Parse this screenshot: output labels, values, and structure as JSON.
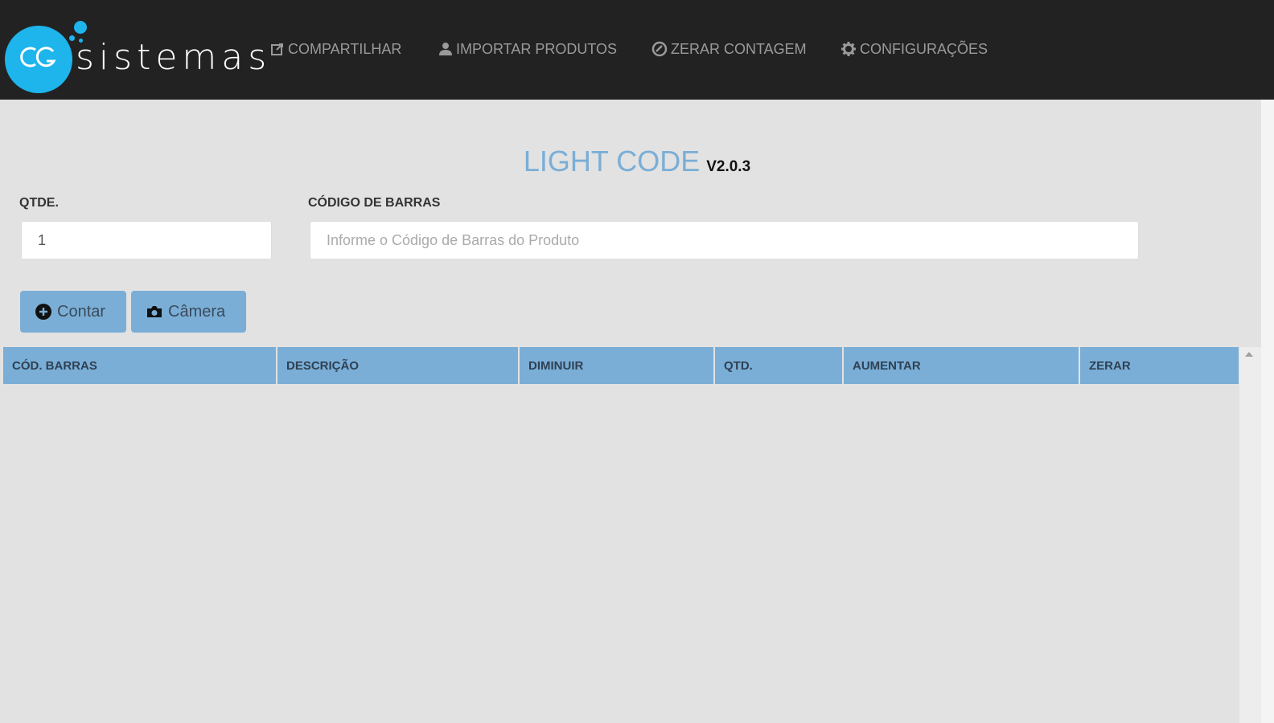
{
  "brand": {
    "name": "sistemas",
    "icon": "cg-logo",
    "accent": "#1eb4ec"
  },
  "nav": [
    {
      "label": "COMPARTILHAR",
      "icon": "share-icon"
    },
    {
      "label": "IMPORTAR PRODUTOS",
      "icon": "user-import-icon"
    },
    {
      "label": "ZERAR CONTAGEM",
      "icon": "ban-icon"
    },
    {
      "label": "CONFIGURAÇÕES",
      "icon": "gear-icon"
    }
  ],
  "title": {
    "main": "LIGHT CODE",
    "version": "V2.0.3"
  },
  "form": {
    "qty_label": "QTDE.",
    "qty_value": "1",
    "barcode_label": "CÓDIGO DE BARRAS",
    "barcode_value": "",
    "barcode_placeholder": "Informe o Código de Barras do Produto"
  },
  "buttons": {
    "count_label": "Contar",
    "camera_label": "Câmera"
  },
  "table": {
    "columns": [
      "CÓD. BARRAS",
      "DESCRIÇÃO",
      "DIMINUIR",
      "QTD.",
      "AUMENTAR",
      "ZERAR"
    ],
    "rows": []
  },
  "colors": {
    "topbar": "#222222",
    "header_blue": "#7aaed6",
    "background": "#e2e2e2"
  }
}
